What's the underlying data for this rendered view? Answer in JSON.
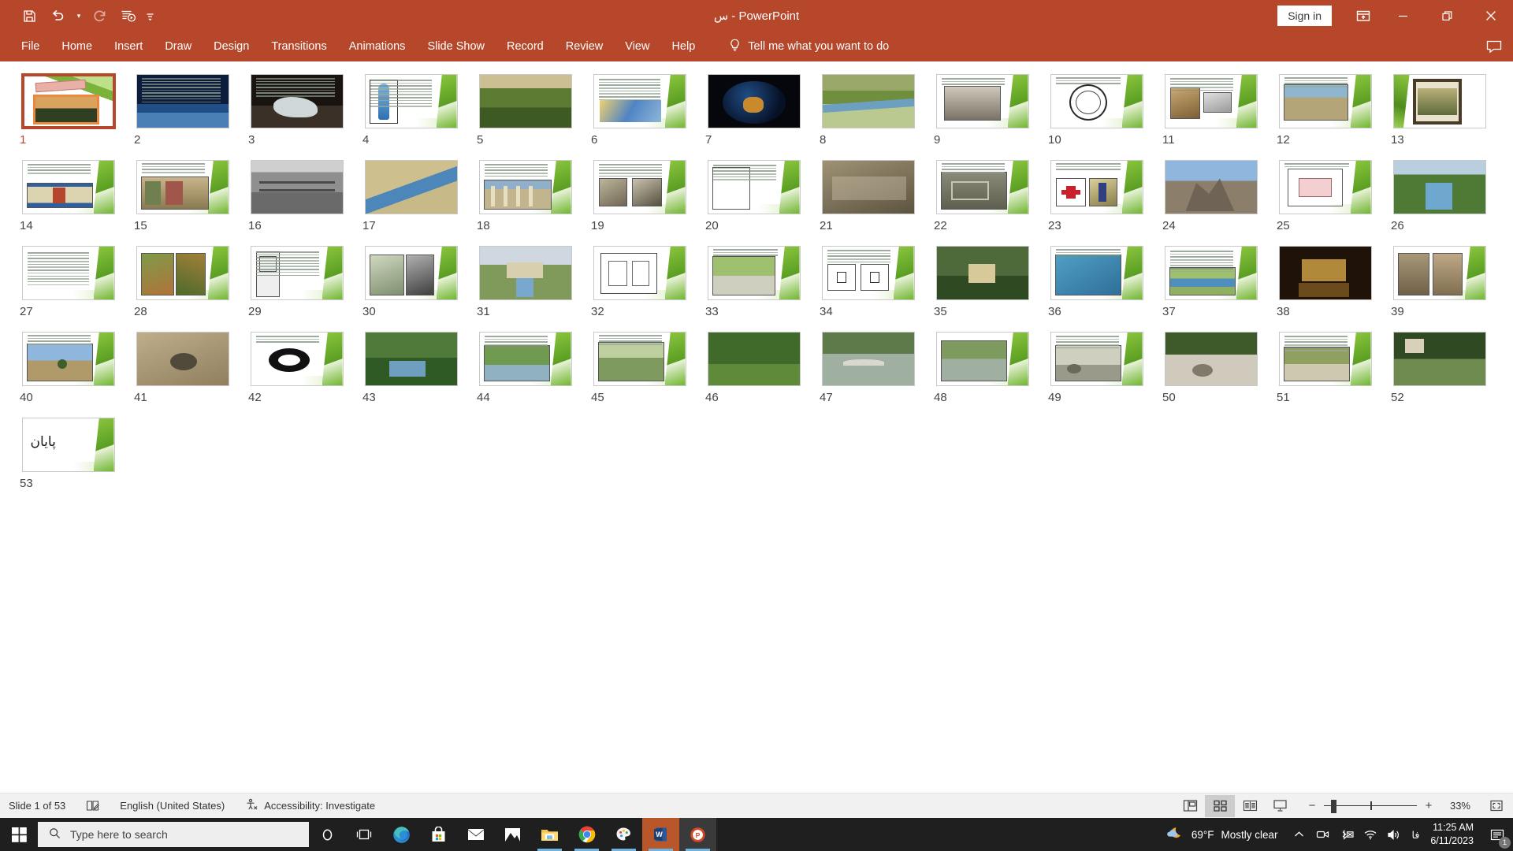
{
  "app": {
    "title": "س  -  PowerPoint",
    "accent_color": "#b7472a",
    "sign_in": "Sign in"
  },
  "quick_access": {
    "items": [
      {
        "name": "save-icon",
        "label": "Save"
      },
      {
        "name": "undo-icon",
        "label": "Undo"
      },
      {
        "name": "undo-dropdown-icon",
        "label": "Undo options"
      },
      {
        "name": "redo-icon",
        "label": "Redo"
      },
      {
        "name": "start-from-beginning-icon",
        "label": "Start From Beginning"
      },
      {
        "name": "customize-qat-icon",
        "label": "Customize Quick Access Toolbar"
      }
    ]
  },
  "window_controls": {
    "ribbon_display": "Ribbon Display Options",
    "minimize": "Minimize",
    "restore": "Restore Down",
    "close": "Close"
  },
  "ribbon": {
    "tabs": [
      "File",
      "Home",
      "Insert",
      "Draw",
      "Design",
      "Transitions",
      "Animations",
      "Slide Show",
      "Record",
      "Review",
      "View",
      "Help"
    ],
    "tell_me": "Tell me what you want to do",
    "comments_label": "Comments"
  },
  "sorter": {
    "slide_count": 53,
    "selected_slide": 1,
    "slides": [
      {
        "n": 1,
        "kind": "title-garden"
      },
      {
        "n": 2,
        "kind": "dark-sea"
      },
      {
        "n": 3,
        "kind": "dark-ice"
      },
      {
        "n": 4,
        "kind": "green-figure"
      },
      {
        "n": 5,
        "kind": "photo-oasis"
      },
      {
        "n": 6,
        "kind": "green-diagram"
      },
      {
        "n": 7,
        "kind": "dark-earth"
      },
      {
        "n": 8,
        "kind": "photo-river"
      },
      {
        "n": 9,
        "kind": "green-engraving"
      },
      {
        "n": 10,
        "kind": "green-circleplan"
      },
      {
        "n": 11,
        "kind": "green-artifact"
      },
      {
        "n": 12,
        "kind": "green-ruins"
      },
      {
        "n": 13,
        "kind": "green-manuscript"
      },
      {
        "n": 14,
        "kind": "green-mural"
      },
      {
        "n": 15,
        "kind": "green-mural2"
      },
      {
        "n": 16,
        "kind": "photo-bw-site"
      },
      {
        "n": 17,
        "kind": "photo-aerial"
      },
      {
        "n": 18,
        "kind": "green-columns"
      },
      {
        "n": 19,
        "kind": "green-reliefs"
      },
      {
        "n": 20,
        "kind": "green-stone"
      },
      {
        "n": 21,
        "kind": "photo-relief"
      },
      {
        "n": 22,
        "kind": "green-excavation"
      },
      {
        "n": 23,
        "kind": "green-symbol"
      },
      {
        "n": 24,
        "kind": "photo-cliff"
      },
      {
        "n": 25,
        "kind": "green-plan"
      },
      {
        "n": 26,
        "kind": "photo-garden-pool"
      },
      {
        "n": 27,
        "kind": "green-text"
      },
      {
        "n": 28,
        "kind": "green-painting"
      },
      {
        "n": 29,
        "kind": "green-drawing"
      },
      {
        "n": 30,
        "kind": "green-sitemap"
      },
      {
        "n": 31,
        "kind": "photo-palace"
      },
      {
        "n": 32,
        "kind": "green-floorplan"
      },
      {
        "n": 33,
        "kind": "green-pathway"
      },
      {
        "n": 34,
        "kind": "green-planpair"
      },
      {
        "n": 35,
        "kind": "photo-pavilion"
      },
      {
        "n": 36,
        "kind": "green-waterpool"
      },
      {
        "n": 37,
        "kind": "green-garden-axis"
      },
      {
        "n": 38,
        "kind": "photo-night-palace"
      },
      {
        "n": 39,
        "kind": "green-texture"
      },
      {
        "n": 40,
        "kind": "green-lonetree"
      },
      {
        "n": 41,
        "kind": "photo-desert"
      },
      {
        "n": 42,
        "kind": "green-oval"
      },
      {
        "n": 43,
        "kind": "photo-jp-garden"
      },
      {
        "n": 44,
        "kind": "green-jp-pond"
      },
      {
        "n": 45,
        "kind": "green-pergola"
      },
      {
        "n": 46,
        "kind": "photo-forest"
      },
      {
        "n": 47,
        "kind": "photo-jp-bridge"
      },
      {
        "n": 48,
        "kind": "green-jp-stone"
      },
      {
        "n": 49,
        "kind": "green-zen"
      },
      {
        "n": 50,
        "kind": "photo-zen-rock"
      },
      {
        "n": 51,
        "kind": "green-zen-wall"
      },
      {
        "n": 52,
        "kind": "photo-jp-courtyard"
      },
      {
        "n": 53,
        "kind": "end-slide",
        "text": "پایان"
      }
    ]
  },
  "status_bar": {
    "slide_indicator": "Slide 1 of 53",
    "notes_icon_label": "Notes",
    "language": "English (United States)",
    "accessibility": "Accessibility: Investigate",
    "views": [
      {
        "name": "normal-view-button",
        "label": "Normal",
        "active": false
      },
      {
        "name": "slide-sorter-view-button",
        "label": "Slide Sorter",
        "active": true
      },
      {
        "name": "reading-view-button",
        "label": "Reading View",
        "active": false
      },
      {
        "name": "slide-show-button",
        "label": "Slide Show",
        "active": false
      }
    ],
    "zoom_out": "−",
    "zoom_in": "+",
    "zoom_level": "33%",
    "fit_label": "Fit slide to current window"
  },
  "taskbar": {
    "search_placeholder": "Type here to search",
    "apps": [
      {
        "name": "cortana-icon",
        "label": "Cortana",
        "running": false
      },
      {
        "name": "task-view-icon",
        "label": "Task View",
        "running": false
      },
      {
        "name": "edge-icon",
        "label": "Microsoft Edge",
        "running": false
      },
      {
        "name": "microsoft-store-icon",
        "label": "Microsoft Store",
        "running": false
      },
      {
        "name": "mail-icon",
        "label": "Mail",
        "running": false
      },
      {
        "name": "photos-icon",
        "label": "Photos",
        "running": false
      },
      {
        "name": "file-explorer-icon",
        "label": "File Explorer",
        "running": true
      },
      {
        "name": "chrome-icon",
        "label": "Google Chrome",
        "running": true
      },
      {
        "name": "paint-3d-icon",
        "label": "Paint 3D",
        "running": true
      },
      {
        "name": "word-icon",
        "label": "Microsoft Word",
        "running": true
      },
      {
        "name": "powerpoint-icon",
        "label": "Microsoft PowerPoint",
        "running": true
      }
    ],
    "weather_temp": "69°F",
    "weather_desc": "Mostly clear",
    "language_indicator": "فا",
    "time": "11:25 AM",
    "date": "6/11/2023",
    "notification_count": "1"
  }
}
